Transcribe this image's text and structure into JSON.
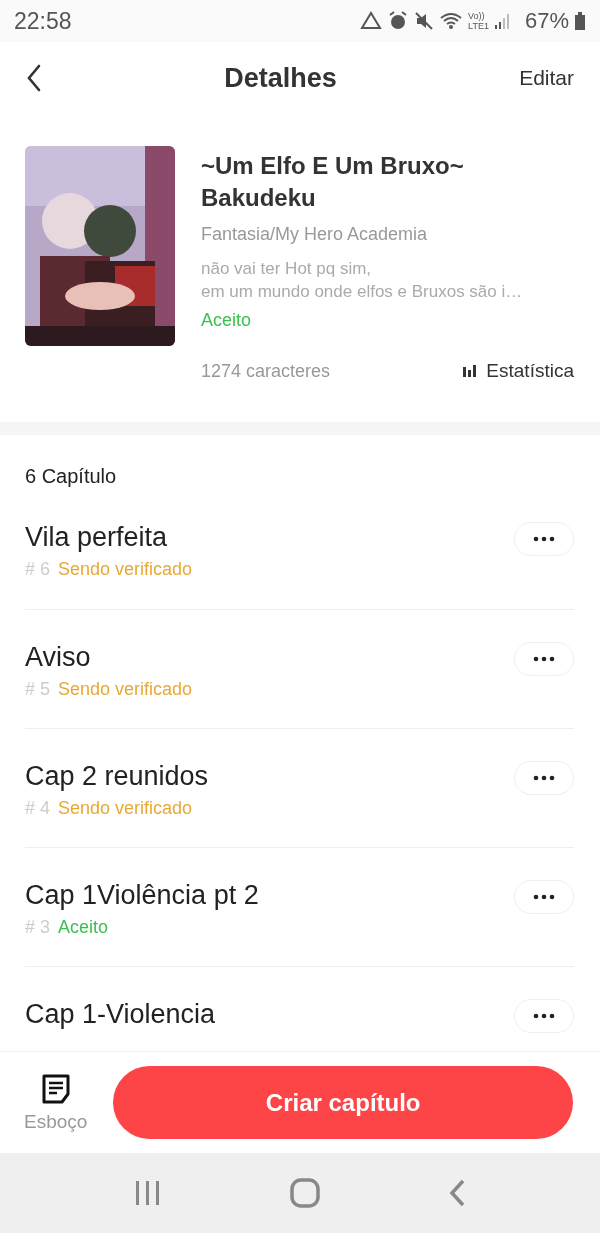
{
  "status_bar": {
    "time": "22:58",
    "network": "Vo))\nLTE1",
    "battery": "67%"
  },
  "header": {
    "title": "Detalhes",
    "action": "Editar"
  },
  "book": {
    "title": "~Um Elfo E Um Bruxo~ Bakudeku",
    "genre": "Fantasia/My Hero Academia",
    "synopsis": "não vai ter Hot pq sim,\nem um mundo onde elfos e Bruxos são i…",
    "status": {
      "label": "Aceito",
      "kind": "accepted"
    },
    "characters": "1274 caracteres",
    "stats_link": "Estatística"
  },
  "chapters": {
    "count_label": "6 Capítulo",
    "items": [
      {
        "title": "Vila perfeita",
        "number": "# 6",
        "status": {
          "label": "Sendo verificado",
          "kind": "review"
        }
      },
      {
        "title": "Aviso",
        "number": "# 5",
        "status": {
          "label": "Sendo verificado",
          "kind": "review"
        }
      },
      {
        "title": "Cap 2 reunidos",
        "number": "# 4",
        "status": {
          "label": "Sendo verificado",
          "kind": "review"
        }
      },
      {
        "title": "Cap 1Violência pt 2",
        "number": "# 3",
        "status": {
          "label": "Aceito",
          "kind": "accepted"
        }
      },
      {
        "title": "Cap 1-Violencia"
      }
    ]
  },
  "bottom_bar": {
    "draft_label": "Esboço",
    "create_button": "Criar capítulo"
  }
}
